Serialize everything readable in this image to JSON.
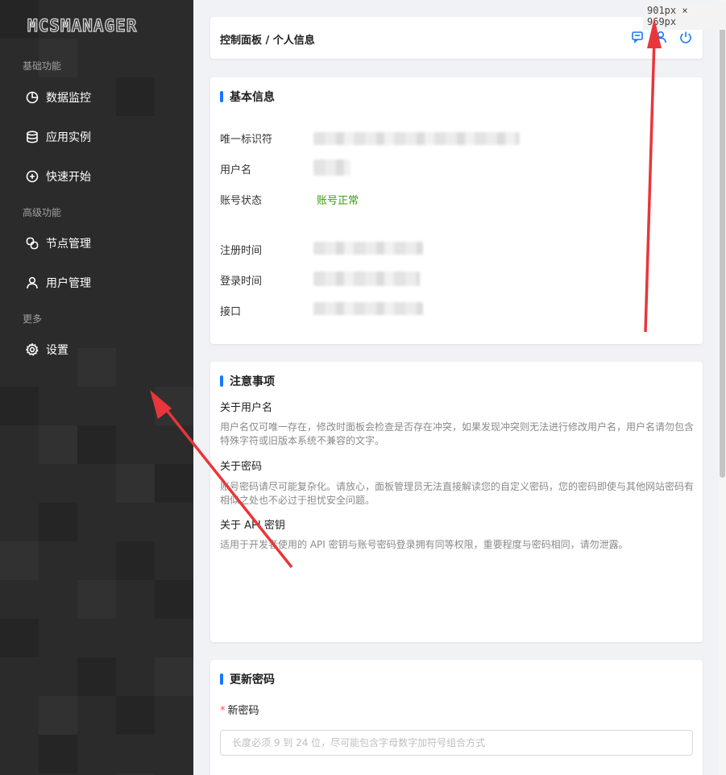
{
  "sidebar": {
    "logo": "MCSMANAGER",
    "groups": [
      {
        "title": "基础功能"
      },
      {
        "title": "高级功能"
      },
      {
        "title": "更多"
      }
    ],
    "items": [
      {
        "label": "数据监控",
        "icon": "pie-chart-icon"
      },
      {
        "label": "应用实例",
        "icon": "database-icon"
      },
      {
        "label": "快速开始",
        "icon": "plus-circle-icon"
      },
      {
        "label": "节点管理",
        "icon": "nodes-icon"
      },
      {
        "label": "用户管理",
        "icon": "user-icon"
      },
      {
        "label": "设置",
        "icon": "gear-icon"
      }
    ]
  },
  "header": {
    "breadcrumb": "控制面板 / 个人信息",
    "icons": [
      "message-icon",
      "user-icon",
      "power-icon"
    ]
  },
  "basic_info": {
    "title": "基本信息",
    "fields": {
      "uuid_label": "唯一标识符",
      "username_label": "用户名",
      "status_label": "账号状态",
      "status_value": "账号正常",
      "register_label": "注册时间",
      "login_label": "登录时间",
      "api_label": "接口"
    }
  },
  "notice": {
    "title": "注意事项",
    "sections": [
      {
        "heading": "关于用户名",
        "text": "用户名仅可唯一存在，修改时面板会检查是否存在冲突，如果发现冲突则无法进行修改用户名，用户名请勿包含特殊字符或旧版本系统不兼容的文字。"
      },
      {
        "heading": "关于密码",
        "text": "账号密码请尽可能复杂化。请放心，面板管理员无法直接解读您的自定义密码，您的密码即使与其他网站密码有相似之处也不必过于担忧安全问题。"
      },
      {
        "heading": "关于 API 密钥",
        "text": "适用于开发者使用的 API 密钥与账号密码登录拥有同等权限，重要程度与密码相同，请勿泄露。"
      }
    ]
  },
  "password": {
    "title": "更新密码",
    "new_password_label": "新密码",
    "required_mark": "*",
    "placeholder": "长度必须 9 到 24 位，尽可能包含字母数字加符号组合方式",
    "value": ""
  },
  "overlay": {
    "dimension_badge": "901px × 969px",
    "arrow_color": "#e8363a"
  },
  "colors": {
    "accent": "#1677ff",
    "success": "#389e0d",
    "sidebar_bg": "#2b2b2b"
  }
}
